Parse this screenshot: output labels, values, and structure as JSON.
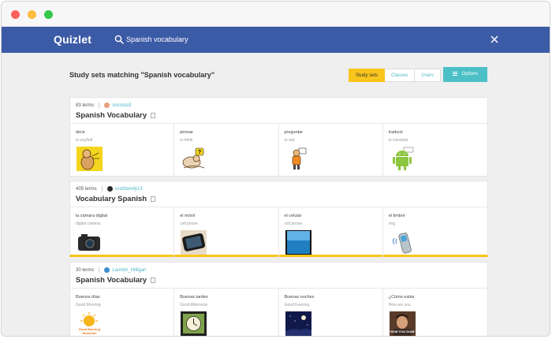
{
  "app": {
    "logo": "Quizlet"
  },
  "search": {
    "value": "Spanish vocabulary"
  },
  "results": {
    "heading": "Study sets matching \"Spanish vocabulary\""
  },
  "filters": {
    "tabs": [
      "Study sets",
      "Classes",
      "Users"
    ],
    "active": "Study sets",
    "options_label": "Options"
  },
  "colors": {
    "navbar": "#3c5ba6",
    "accent_yellow": "#f8c51c",
    "accent_teal": "#4bc0c6",
    "link": "#4bb7c9"
  },
  "sets": [
    {
      "terms_count": "83 terms",
      "user": "sncosta3",
      "title": "Spanish Vocabulary",
      "terms": [
        {
          "word": "decir",
          "def": "to say/tell",
          "icon": "cartoon-speaking-image"
        },
        {
          "word": "pensar",
          "def": "to think",
          "icon": "cartoon-thinking-image"
        },
        {
          "word": "preguntar",
          "def": "to ask",
          "icon": "cartoon-asking-image"
        },
        {
          "word": "traducir",
          "def": "to translate",
          "icon": "android-translate-image"
        }
      ]
    },
    {
      "terms_count": "405 terms",
      "user": "scottfamily13",
      "title": "Vocabulary Spanish",
      "terms": [
        {
          "word": "la cámara digital",
          "def": "digital camera",
          "icon": "camera-image"
        },
        {
          "word": "el móvil",
          "def": "cell phone",
          "icon": "phone-image"
        },
        {
          "word": "el celular",
          "def": "cell phone",
          "icon": "cellphone-screen-image"
        },
        {
          "word": "el timbre",
          "def": "ring",
          "icon": "ringing-phone-image"
        }
      ]
    },
    {
      "terms_count": "30 terms",
      "user": "Landon_Hilligan",
      "title": "Spanish Vocabulary",
      "terms": [
        {
          "word": "Buenos días",
          "def": "Good Morning",
          "icon": "sunrise-image"
        },
        {
          "word": "Buenas tardes",
          "def": "Good Afternoon",
          "icon": "clock-image"
        },
        {
          "word": "Buenas noches",
          "def": "Good Evening",
          "icon": "night-sky-image"
        },
        {
          "word": "¿Cómo estás",
          "def": "How are you",
          "icon": "how-you-doin-image"
        }
      ],
      "image_captions": {
        "sunrise": "Good Morning Sunshine",
        "doin": "HOW YOU DOIN'"
      }
    }
  ]
}
